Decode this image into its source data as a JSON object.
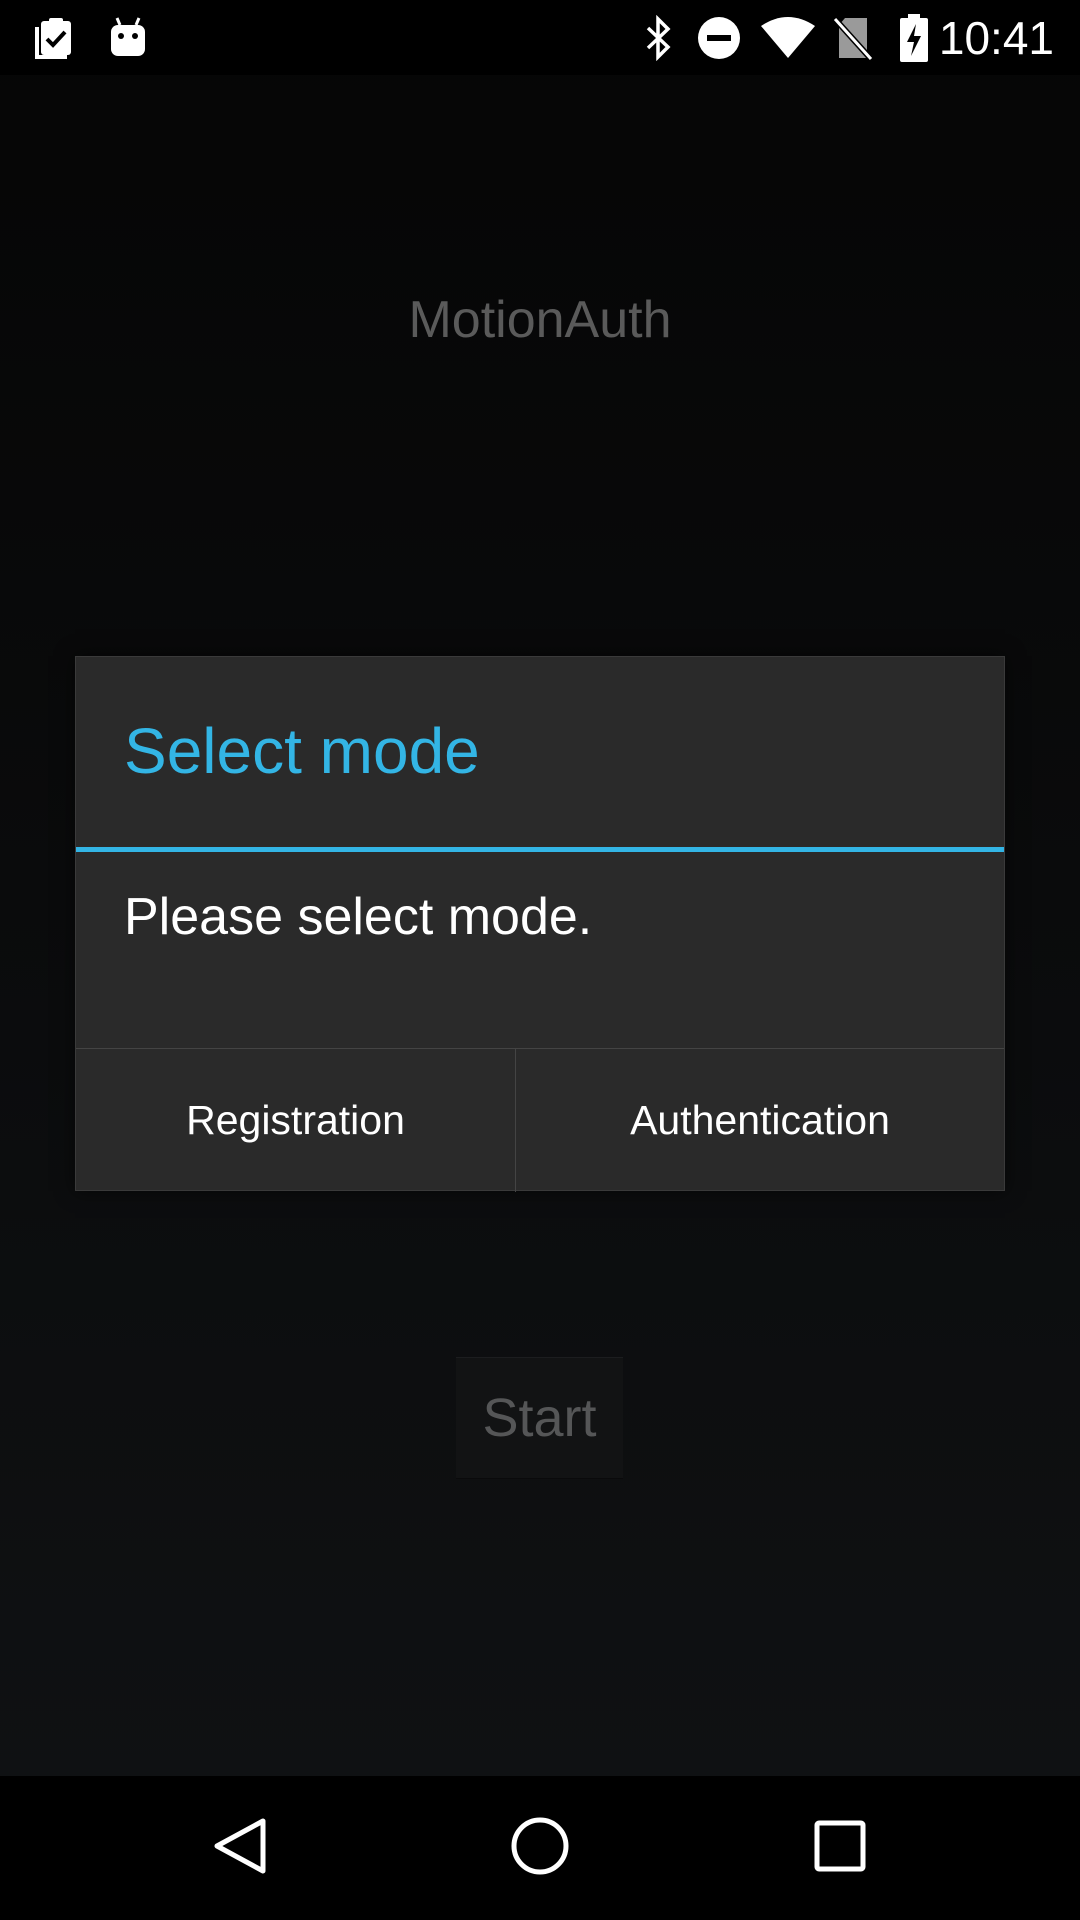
{
  "status_bar": {
    "time": "10:41",
    "left_icons": [
      "clipboard-check-icon",
      "android-debug-icon"
    ],
    "right_icons": [
      "bluetooth-icon",
      "do-not-disturb-icon",
      "wifi-icon",
      "no-sim-icon",
      "battery-charging-icon"
    ]
  },
  "app": {
    "title": "MotionAuth",
    "start_label": "Start"
  },
  "dialog": {
    "title": "Select mode",
    "message": "Please select mode.",
    "buttons": {
      "registration": "Registration",
      "authentication": "Authentication"
    },
    "accent_color": "#33b5e5"
  },
  "nav_bar": {
    "icons": [
      "back-icon",
      "home-icon",
      "recents-icon"
    ]
  }
}
